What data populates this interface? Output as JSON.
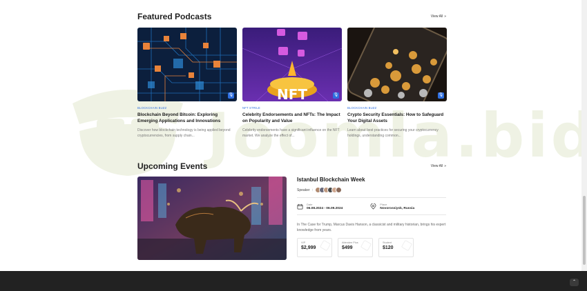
{
  "featured": {
    "title": "Featured Podcasts",
    "view_all": "View All",
    "cards": [
      {
        "category": "BLOCKCHAIN BUZZ",
        "title": "Blockchain Beyond Bitcoin: Exploring Emerging Applications and Innovations",
        "desc": "Discover how blockchain technology is being applied beyond cryptocurrencies, from supply chain...",
        "icon": "microphone-icon",
        "image": "blockchain-circuit-image"
      },
      {
        "category": "NFT STRILE",
        "title": "Celebrity Endorsements and NFTs: The Impact on Popularity and Value",
        "desc": "Celebrity endorsements have a significant influence on the NFT market. We analyze the effect of...",
        "icon": "microphone-icon",
        "image": "nft-platform-image",
        "image_text": "NFT"
      },
      {
        "category": "BLOCKCHAIN BUZZ",
        "title": "Crypto Security Essentials: How to Safeguard Your Digital Assets",
        "desc": "Learn about best practices for securing your cryptocurrency holdings, understanding common...",
        "icon": "microphone-icon",
        "image": "crypto-coins-phone-image"
      }
    ]
  },
  "events": {
    "title": "Upcoming Events",
    "view_all": "View All",
    "event": {
      "title": "Istanbul Blockchain Week",
      "speaker_label": "Speaker",
      "date_label": "Date",
      "date_value": "06.08.2024 - 06.09.2024",
      "place_label": "Place",
      "place_value": "Novorossiysk, Russia",
      "description": "In The Case for Trump, Marcus Davis Hanson, a classicist and military historian, brings his expert knowledge from years.",
      "prices": [
        {
          "label": "VIP",
          "value": "$2,999"
        },
        {
          "label": "Attendee Plus",
          "value": "$499"
        },
        {
          "label": "Student",
          "value": "$120"
        }
      ]
    }
  },
  "watermark": "Joomla.bid",
  "colors": {
    "accent": "#2f6fe0",
    "footer": "#222222"
  }
}
